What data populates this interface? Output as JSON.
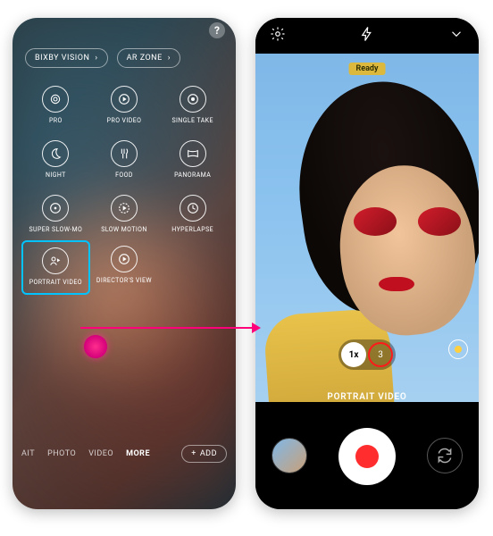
{
  "left": {
    "help_glyph": "?",
    "top_buttons": [
      {
        "label": "BIXBY VISION",
        "chevron": "›"
      },
      {
        "label": "AR ZONE",
        "chevron": "›"
      }
    ],
    "modes_row1": [
      {
        "id": "pro",
        "label": "PRO"
      },
      {
        "id": "pro-video",
        "label": "PRO VIDEO"
      },
      {
        "id": "single-take",
        "label": "SINGLE TAKE"
      }
    ],
    "modes_row2": [
      {
        "id": "night",
        "label": "NIGHT"
      },
      {
        "id": "food",
        "label": "FOOD"
      },
      {
        "id": "panorama",
        "label": "PANORAMA"
      }
    ],
    "modes_row3": [
      {
        "id": "super-slow-mo",
        "label": "SUPER SLOW-MO"
      },
      {
        "id": "slow-motion",
        "label": "SLOW MOTION"
      },
      {
        "id": "hyperlapse",
        "label": "HYPERLAPSE"
      }
    ],
    "modes_row4": [
      {
        "id": "portrait-video",
        "label": "PORTRAIT VIDEO"
      },
      {
        "id": "directors-view",
        "label": "DIRECTOR'S VIEW"
      }
    ],
    "tabs": {
      "items": [
        "AIT",
        "PHOTO",
        "VIDEO",
        "MORE"
      ],
      "active_index": 3,
      "add_label": "ADD",
      "add_glyph": "+"
    }
  },
  "right": {
    "status_badge": "Ready",
    "zoom": {
      "options": [
        "1x",
        "3"
      ],
      "active_index": 0,
      "highlight_index": 1
    },
    "mode_label": "PORTRAIT VIDEO"
  }
}
